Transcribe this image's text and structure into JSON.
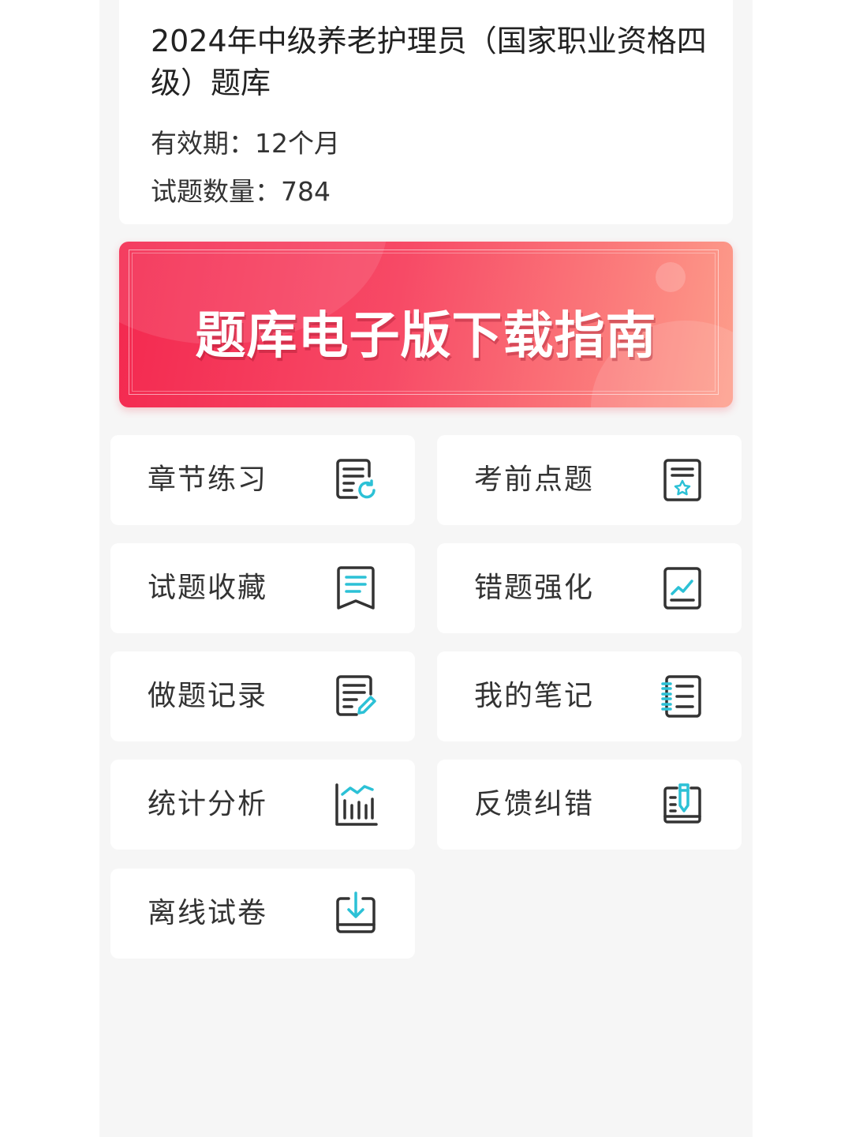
{
  "course": {
    "title": "2024年中级养老护理员（国家职业资格四级）题库",
    "validity": "有效期：12个月",
    "question_count": "试题数量：784"
  },
  "banner": {
    "text": "题库电子版下载指南"
  },
  "menu": [
    {
      "label": "章节练习",
      "icon": "list-refresh-icon"
    },
    {
      "label": "考前点题",
      "icon": "star-document-icon"
    },
    {
      "label": "试题收藏",
      "icon": "bookmark-icon"
    },
    {
      "label": "错题强化",
      "icon": "trend-chart-icon"
    },
    {
      "label": "做题记录",
      "icon": "document-edit-icon"
    },
    {
      "label": "我的笔记",
      "icon": "notebook-icon"
    },
    {
      "label": "统计分析",
      "icon": "bar-chart-icon"
    },
    {
      "label": "反馈纠错",
      "icon": "feedback-pen-icon"
    },
    {
      "label": "离线试卷",
      "icon": "download-tray-icon"
    }
  ],
  "colors": {
    "accent": "#2cc1d6",
    "icon_stroke": "#333333",
    "banner_start": "#f3284f",
    "banner_end": "#fd9e8b"
  }
}
